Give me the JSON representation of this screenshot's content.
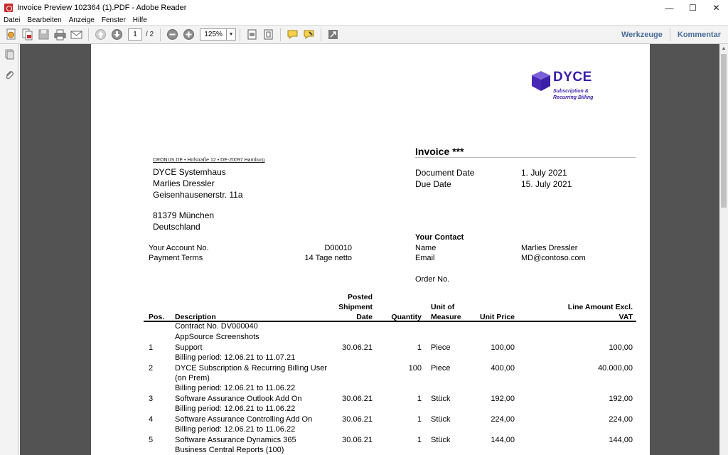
{
  "window": {
    "title": "Invoice Preview 102364 (1).PDF - Adobe Reader",
    "minimize": "—",
    "maximize": "☐",
    "close": "✕"
  },
  "menu": [
    "Datei",
    "Bearbeiten",
    "Anzeige",
    "Fenster",
    "Hilfe"
  ],
  "toolbar": {
    "page_current": "1",
    "page_total": "/ 2",
    "zoom": "125%",
    "tools_label": "Werkzeuge",
    "comment_label": "Kommentar"
  },
  "doc": {
    "logo": {
      "word": "DYCE",
      "sub_line1": "Subscription &",
      "sub_line2": "Recurring Billing",
      "color": "#3a1fa8"
    },
    "sender_line": "CRONUS DE • Hofstraße 12 • DE-20097 Hamburg",
    "address": [
      "DYCE Systemhaus",
      "Marlies Dressler",
      "Geisenhausenerstr. 11a",
      "81379 München",
      "Deutschland"
    ],
    "title": "Invoice ***",
    "document_date_label": "Document Date",
    "document_date": "1. July 2021",
    "due_date_label": "Due Date",
    "due_date": "15. July 2021",
    "account_label": "Your Account No.",
    "account_value": "D00010",
    "payment_label": "Payment Terms",
    "payment_value": "14 Tage netto",
    "contact_heading": "Your Contact",
    "contact_name_label": "Name",
    "contact_name": "Marlies Dressler",
    "contact_email_label": "Email",
    "contact_email": "MD@contoso.com",
    "order_label": "Order No.",
    "headers": {
      "pos": "Pos.",
      "description": "Description",
      "posted_1": "Posted",
      "posted_2": "Shipment",
      "posted_3": "Date",
      "quantity": "Quantity",
      "unit_1": "Unit of",
      "unit_2": "Measure",
      "unit_price": "Unit Price",
      "amount_1": "Line Amount Excl.",
      "amount_2": "VAT"
    },
    "pre_lines": [
      "Contract No. DV000040",
      "AppSource Screenshots"
    ],
    "lines": [
      {
        "pos": "1",
        "desc": "Support",
        "date": "30.06.21",
        "qty": "1",
        "unit": "Piece",
        "price": "100,00",
        "amount": "100,00",
        "extra": [
          "Billing period: 12.06.21 to 11.07.21"
        ]
      },
      {
        "pos": "2",
        "desc": "DYCE Subscription & Recurring Billing User",
        "date": "",
        "qty": "100",
        "unit": "Piece",
        "price": "400,00",
        "amount": "40.000,00",
        "extra": [
          "(on Prem)",
          "Billing period: 12.06.21 to 11.06.22"
        ]
      },
      {
        "pos": "3",
        "desc": "Software Assurance Outlook Add On",
        "date": "30.06.21",
        "qty": "1",
        "unit": "Stück",
        "price": "192,00",
        "amount": "192,00",
        "extra": [
          "Billing period: 12.06.21 to 11.06.22"
        ]
      },
      {
        "pos": "4",
        "desc": "Software Assurance Controlling Add On",
        "date": "30.06.21",
        "qty": "1",
        "unit": "Stück",
        "price": "224,00",
        "amount": "224,00",
        "extra": [
          "Billing period: 12.06.21 to 11.06.22"
        ]
      },
      {
        "pos": "5",
        "desc": "Software Assurance Dynamics 365",
        "date": "30.06.21",
        "qty": "1",
        "unit": "Stück",
        "price": "144,00",
        "amount": "144,00",
        "extra": [
          "Business Central Reports (100)"
        ]
      }
    ]
  }
}
